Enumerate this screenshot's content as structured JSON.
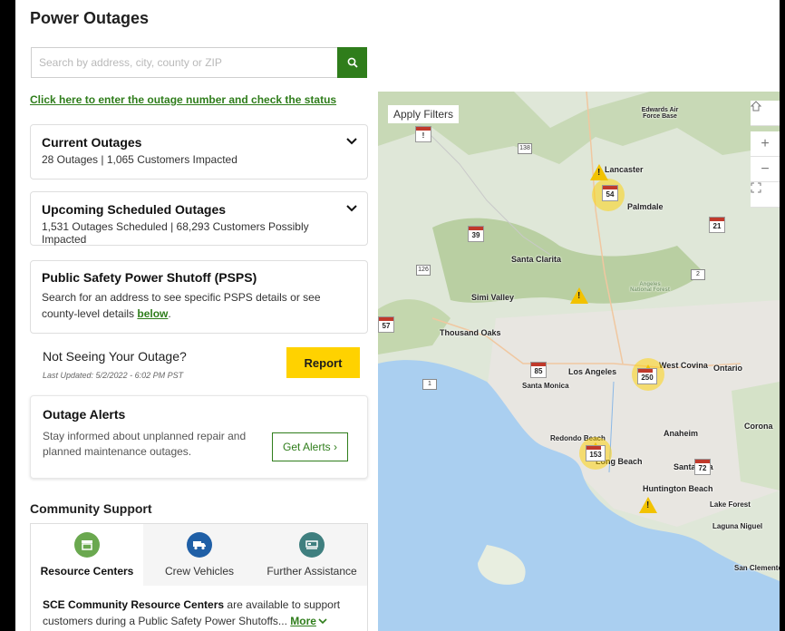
{
  "title": "Power Outages",
  "search": {
    "placeholder": "Search by address, city, county or ZIP"
  },
  "status_link": "Click here to enter the outage number and check the status",
  "current": {
    "title": "Current Outages",
    "summary": "28 Outages | 1,065 Customers Impacted"
  },
  "upcoming": {
    "title": "Upcoming Scheduled Outages",
    "summary": "1,531 Outages Scheduled | 68,293 Customers Possibly Impacted"
  },
  "psps": {
    "title": "Public Safety Power Shutoff (PSPS)",
    "desc": "Search for an address to see specific PSPS details or see county-level details ",
    "link": "below",
    "period": "."
  },
  "report": {
    "heading": "Not Seeing Your Outage?",
    "updated": "Last Updated: 5/2/2022 - 6:02 PM PST",
    "button": "Report"
  },
  "alerts": {
    "title": "Outage Alerts",
    "desc": "Stay informed about unplanned repair and planned maintenance outages.",
    "button": "Get Alerts ›"
  },
  "community": {
    "heading": "Community Support",
    "tabs": [
      {
        "label": "Resource Centers",
        "color": "#6aa84f"
      },
      {
        "label": "Crew Vehicles",
        "color": "#1f5fa6"
      },
      {
        "label": "Further Assistance",
        "color": "#3f7f7f"
      }
    ],
    "body_bold": "SCE Community Resource Centers",
    "body": " are available to support customers during a Public Safety Power Shutoffs... ",
    "more": "More"
  },
  "map": {
    "apply_filters": "Apply Filters",
    "controls": {
      "zoom_in": "+",
      "zoom_out": "−"
    },
    "cities": [
      "Lancaster",
      "Palmdale",
      "Santa Clarita",
      "Simi Valley",
      "Thousand Oaks",
      "Los Angeles",
      "Santa Monica",
      "West Covina",
      "Ontario",
      "Corona",
      "Redondo Beach",
      "Long Beach",
      "Anaheim",
      "Santa Ana",
      "Huntington Beach",
      "Lake Forest",
      "Laguna Niguel",
      "San Clemente",
      "Edwards Air Force Base",
      "Angeles National Forest"
    ],
    "markers": [
      "54",
      "39",
      "21",
      "57",
      "85",
      "250",
      "153",
      "72"
    ],
    "shields": [
      "138",
      "126",
      "2",
      "1"
    ]
  }
}
